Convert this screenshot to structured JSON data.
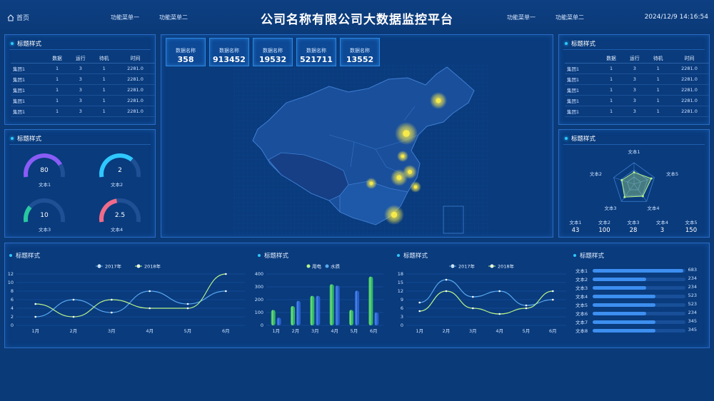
{
  "header": {
    "home_label": "首页",
    "title": "公司名称有限公司大数据监控平台",
    "nav_left": [
      "功能菜单一",
      "功能菜单二"
    ],
    "nav_right": [
      "功能菜单一",
      "功能菜单二"
    ],
    "datetime": "2024/12/9 14:16:54"
  },
  "left_table": {
    "title": "标题样式",
    "columns": [
      "",
      "数据",
      "运行",
      "待机",
      "时间"
    ],
    "rows": [
      [
        "集团1",
        "1",
        "3",
        "1",
        "2281.0"
      ],
      [
        "集团1",
        "1",
        "3",
        "1",
        "2281.0"
      ],
      [
        "集团1",
        "1",
        "3",
        "1",
        "2281.0"
      ],
      [
        "集团1",
        "1",
        "3",
        "1",
        "2281.0"
      ],
      [
        "集团1",
        "1",
        "3",
        "1",
        "2281.0"
      ]
    ]
  },
  "right_table": {
    "title": "标题样式",
    "columns": [
      "",
      "数据",
      "运行",
      "待机",
      "时间"
    ],
    "rows": [
      [
        "集团1",
        "1",
        "3",
        "1",
        "2281.0"
      ],
      [
        "集团1",
        "1",
        "3",
        "1",
        "2281.0"
      ],
      [
        "集团1",
        "1",
        "3",
        "1",
        "2281.0"
      ],
      [
        "集团1",
        "1",
        "3",
        "1",
        "2281.0"
      ],
      [
        "集团1",
        "1",
        "3",
        "1",
        "2281.0"
      ]
    ]
  },
  "gauges": {
    "title": "标题样式",
    "items": [
      {
        "value": "80",
        "label": "文本1",
        "fraction": 0.8,
        "color": "#8a5cf6"
      },
      {
        "value": "2",
        "label": "文本2",
        "fraction": 0.7,
        "color": "#2ec8ff"
      },
      {
        "value": "10",
        "label": "文本3",
        "fraction": 0.25,
        "color": "#28c8a0"
      },
      {
        "value": "2.5",
        "label": "文本4",
        "fraction": 0.45,
        "color": "#f06b8a"
      }
    ]
  },
  "stats": [
    {
      "label": "数据名称",
      "value": "358"
    },
    {
      "label": "数据名称",
      "value": "913452"
    },
    {
      "label": "数据名称",
      "value": "19532"
    },
    {
      "label": "数据名称",
      "value": "521711"
    },
    {
      "label": "数据名称",
      "value": "13552"
    }
  ],
  "radar": {
    "title": "标题样式",
    "axes": [
      "文本1",
      "文本5",
      "文本4",
      "文本3",
      "文本2"
    ],
    "stats": [
      {
        "label": "文本1",
        "value": "43"
      },
      {
        "label": "文本2",
        "value": "100"
      },
      {
        "label": "文本3",
        "value": "28"
      },
      {
        "label": "文本4",
        "value": "3"
      },
      {
        "label": "文本5",
        "value": "150"
      }
    ]
  },
  "colors": {
    "accent": "#2ec8ff",
    "line_green": "#b8f28a",
    "line_blue": "#5aa8f0",
    "hotspot": "#f6e94a"
  },
  "chart_data": [
    {
      "type": "line",
      "title": "标题样式",
      "categories": [
        "1月",
        "2月",
        "3月",
        "4月",
        "5月",
        "6月"
      ],
      "series": [
        {
          "name": "2017年",
          "values": [
            2,
            6,
            3,
            8,
            5,
            8
          ]
        },
        {
          "name": "2018年",
          "values": [
            5,
            2,
            6,
            4,
            4,
            12
          ]
        }
      ],
      "ylim": [
        0,
        12
      ],
      "yticks": [
        0,
        2,
        4,
        6,
        8,
        10,
        12
      ],
      "legend": "top-center"
    },
    {
      "type": "bar",
      "title": "标题样式",
      "categories": [
        "1月",
        "2月",
        "3月",
        "4月",
        "5月",
        "6月"
      ],
      "series": [
        {
          "name": "用电",
          "values": [
            120,
            150,
            230,
            320,
            120,
            380
          ]
        },
        {
          "name": "水质",
          "values": [
            60,
            190,
            230,
            310,
            270,
            100
          ]
        }
      ],
      "ylim": [
        0,
        400
      ],
      "yticks": [
        0,
        100,
        200,
        300,
        400
      ],
      "legend": "top-center"
    },
    {
      "type": "line",
      "title": "标题样式",
      "categories": [
        "1月",
        "2月",
        "3月",
        "4月",
        "5月",
        "6月"
      ],
      "series": [
        {
          "name": "2017年",
          "values": [
            8,
            16,
            10,
            12,
            7,
            9
          ]
        },
        {
          "name": "2018年",
          "values": [
            5,
            12,
            6,
            4,
            6,
            12
          ]
        }
      ],
      "ylim": [
        0,
        18
      ],
      "yticks": [
        0,
        3,
        6,
        9,
        12,
        15,
        18
      ],
      "legend": "top-center"
    }
  ],
  "hbar": {
    "title": "标题样式",
    "items": [
      {
        "label": "文本1",
        "value": "683",
        "fraction": 0.98
      },
      {
        "label": "文本2",
        "value": "234",
        "fraction": 0.58
      },
      {
        "label": "文本3",
        "value": "234",
        "fraction": 0.58
      },
      {
        "label": "文本4",
        "value": "523",
        "fraction": 0.68
      },
      {
        "label": "文本5",
        "value": "523",
        "fraction": 0.68
      },
      {
        "label": "文本6",
        "value": "234",
        "fraction": 0.58
      },
      {
        "label": "文本7",
        "value": "345",
        "fraction": 0.68
      },
      {
        "label": "文本8",
        "value": "345",
        "fraction": 0.68
      }
    ]
  }
}
